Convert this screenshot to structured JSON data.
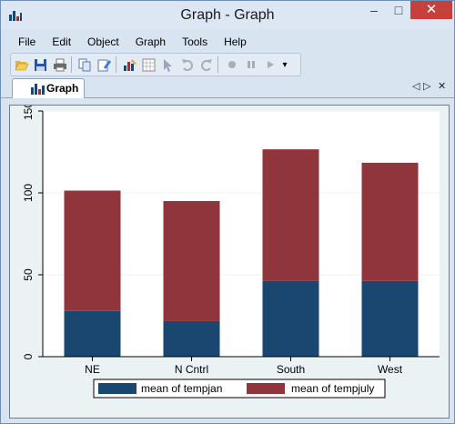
{
  "window": {
    "title": "Graph - Graph"
  },
  "window_controls": {
    "minimize": "–",
    "maximize": "□",
    "close": "✕"
  },
  "menu": [
    "File",
    "Edit",
    "Object",
    "Graph",
    "Tools",
    "Help"
  ],
  "toolbar": {
    "icons": [
      "open-icon",
      "save-icon",
      "print-icon",
      "copy-icon",
      "rename-icon",
      "graph-editor-icon",
      "data-editor-icon",
      "pointer-icon",
      "undo-icon",
      "redo-icon",
      "record-icon",
      "pause-icon",
      "play-icon"
    ],
    "overflow": "▾"
  },
  "tabs": [
    {
      "label": "Graph",
      "icon": "bar-chart-icon"
    }
  ],
  "tab_controls": {
    "prev": "◁",
    "next": "▷",
    "close": "✕"
  },
  "colors": {
    "series1": "#1a476f",
    "series2": "#90353b",
    "plot_bg": "#ffffff",
    "graph_bg": "#eaf2f3",
    "close_button": "#c7413c"
  },
  "chart_data": {
    "type": "bar",
    "stacked": true,
    "categories": [
      "NE",
      "N Cntrl",
      "South",
      "West"
    ],
    "series": [
      {
        "name": "mean of tempjan",
        "values": [
          27.9,
          21.7,
          46.3,
          46.2
        ]
      },
      {
        "name": "mean of tempjuly",
        "values": [
          73.5,
          73.3,
          80.3,
          72.2
        ]
      }
    ],
    "yticks": [
      0,
      50,
      100,
      150
    ],
    "ylim": [
      0,
      150
    ],
    "grid": true,
    "legend_position": "bottom"
  }
}
